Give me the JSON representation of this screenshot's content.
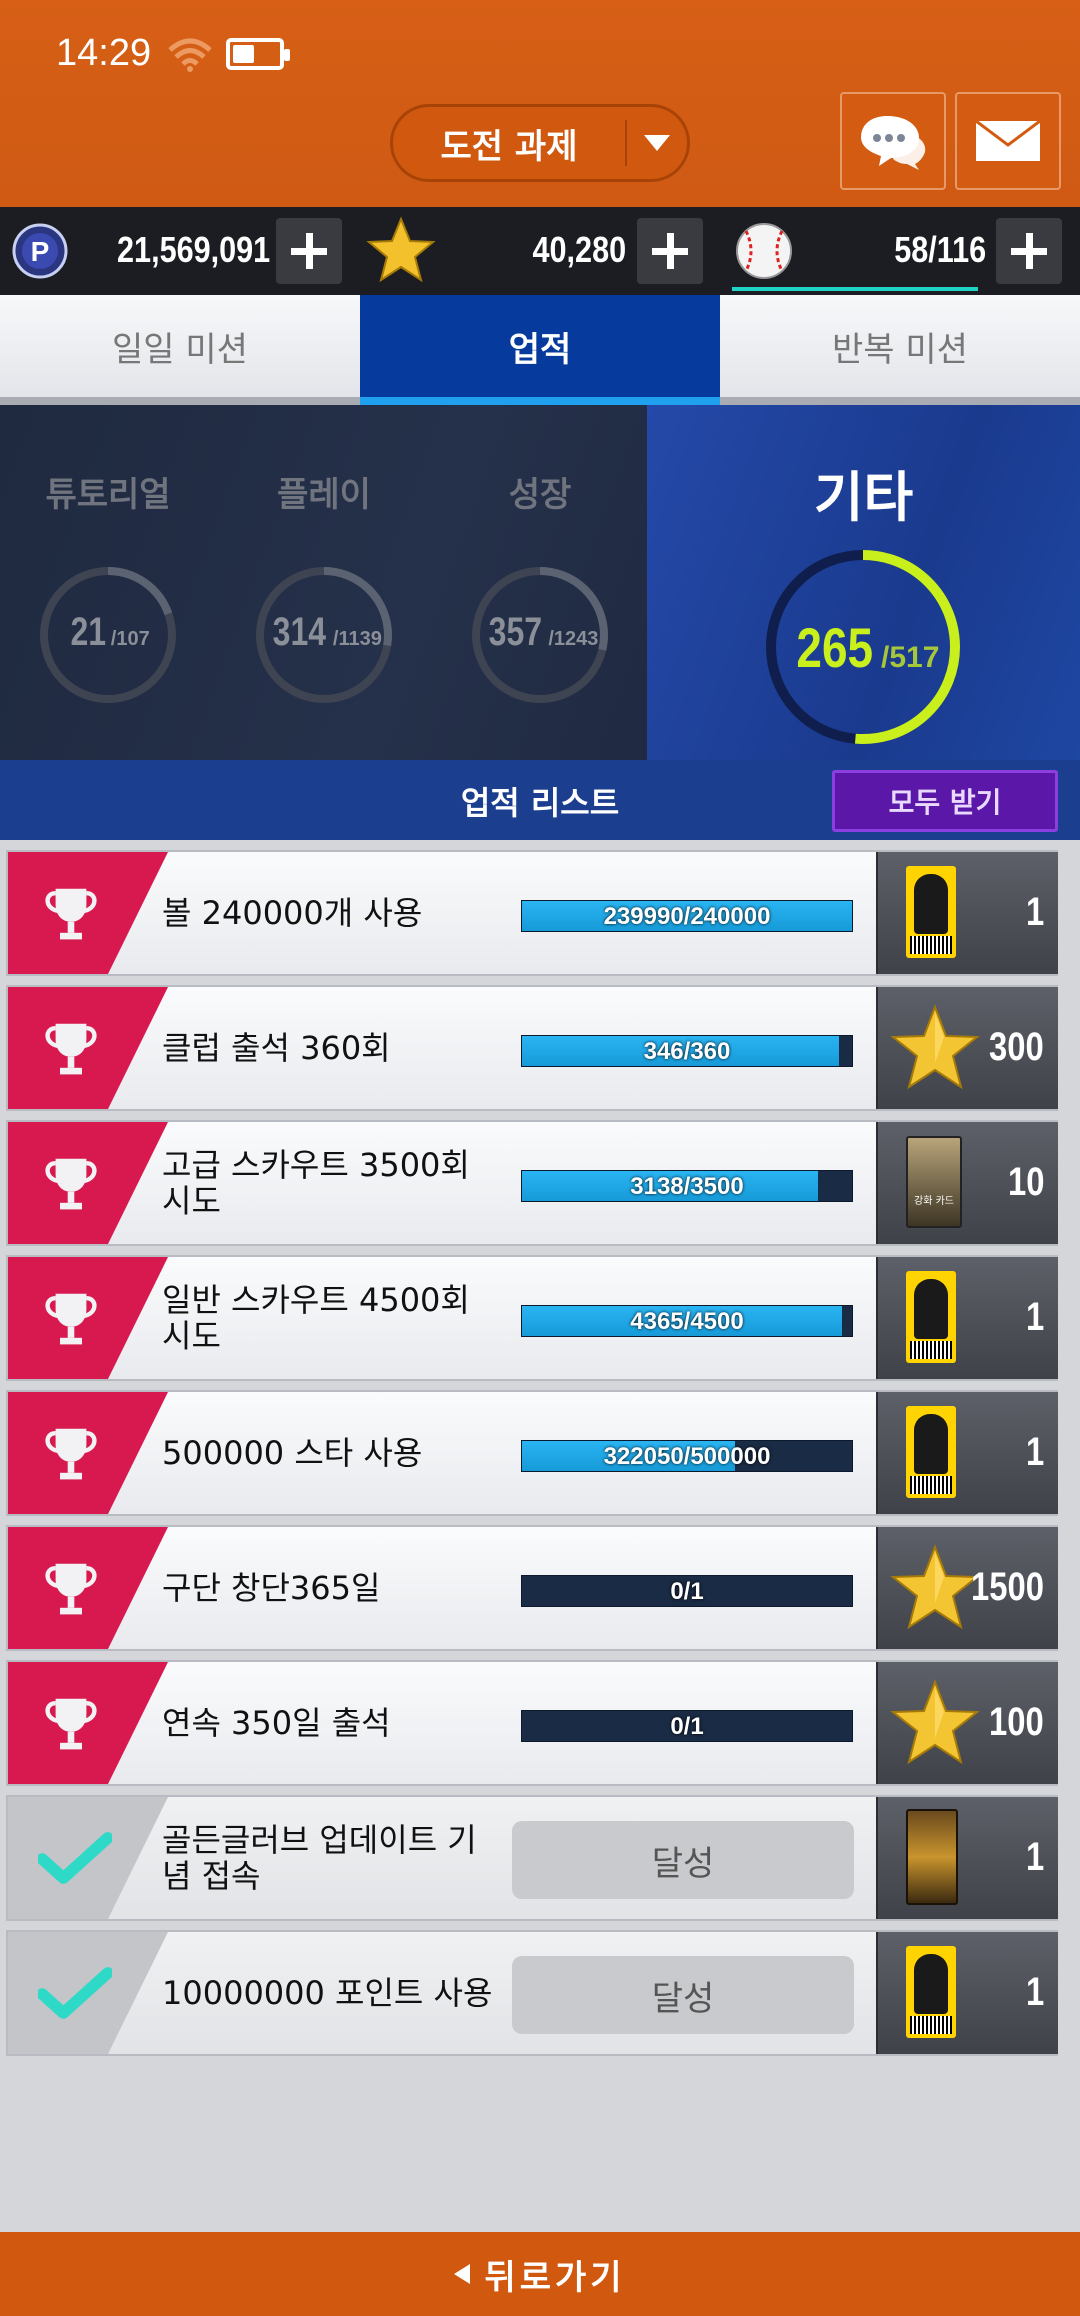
{
  "status": {
    "time": "14:29",
    "battery_percent": 45
  },
  "header": {
    "dropdown_label": "도전 과제"
  },
  "currency": {
    "points": "21,569,091",
    "stars": "40,280",
    "balls": "58/116"
  },
  "tabs": [
    {
      "label": "일일 미션"
    },
    {
      "label": "업적"
    },
    {
      "label": "반복 미션"
    }
  ],
  "categories": [
    {
      "name": "튜토리얼",
      "done": "21",
      "total": "/107",
      "progress": 0.196
    },
    {
      "name": "플레이",
      "done": "314",
      "total": "/1139",
      "progress": 0.276
    },
    {
      "name": "성장",
      "done": "357",
      "total": "/1243",
      "progress": 0.287
    },
    {
      "name": "기타",
      "done": "265",
      "total": "/517",
      "progress": 0.513
    }
  ],
  "list": {
    "title": "업적 리스트",
    "claim_all": "모두 받기"
  },
  "rows": [
    {
      "title": "볼 240000개 사용",
      "progress_text": "239990/240000",
      "progress": 0.99996,
      "reward_type": "ticket",
      "reward_amount": "1"
    },
    {
      "title": "클럽 출석 360회",
      "progress_text": "346/360",
      "progress": 0.961,
      "reward_type": "star",
      "reward_amount": "300"
    },
    {
      "title": "고급 스카우트 3500회 시도",
      "progress_text": "3138/3500",
      "progress": 0.897,
      "reward_type": "card",
      "reward_card_text": "강화 카드",
      "reward_amount": "10"
    },
    {
      "title": "일반 스카우트 4500회 시도",
      "progress_text": "4365/4500",
      "progress": 0.97,
      "reward_type": "ticket",
      "reward_amount": "1"
    },
    {
      "title": "500000 스타 사용",
      "progress_text": "322050/500000",
      "progress": 0.644,
      "reward_type": "ticket",
      "reward_amount": "1"
    },
    {
      "title": "구단 창단365일",
      "progress_text": "0/1",
      "progress": 0,
      "reward_type": "star",
      "reward_amount": "1500"
    },
    {
      "title": "연속 350일 출석",
      "progress_text": "0/1",
      "progress": 0,
      "reward_type": "star",
      "reward_amount": "100"
    },
    {
      "title": "골든글러브 업데이트 기념 접속",
      "done_label": "달성",
      "reward_type": "pack",
      "reward_amount": "1"
    },
    {
      "title": "10000000 포인트 사용",
      "done_label": "달성",
      "reward_type": "ticket",
      "reward_amount": "1"
    }
  ],
  "footer": {
    "back_label": "뒤로가기"
  },
  "colors": {
    "accent": "#d0580f",
    "tab_active": "#063a9c",
    "trophy_red": "#d8194f",
    "done_teal": "#2fd9c8",
    "ring_active": "#c9f01c"
  }
}
